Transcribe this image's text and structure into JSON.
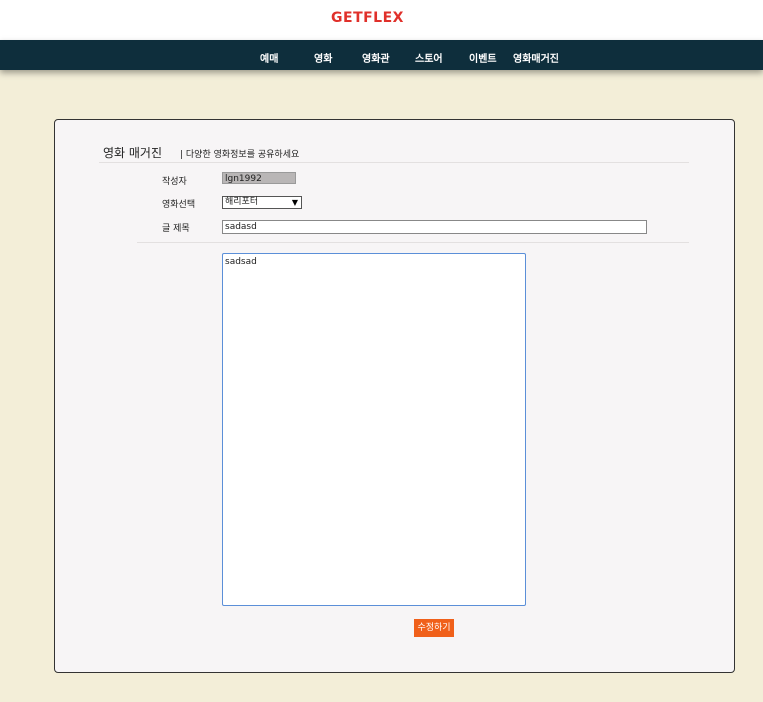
{
  "header": {
    "logo": "GETFLEX"
  },
  "nav": {
    "items": [
      "예매",
      "영화",
      "영화관",
      "스토어",
      "이벤트",
      "영화매거진"
    ]
  },
  "board": {
    "title": "영화 매거진",
    "subtitle": "| 다양한 영화정보를 공유하세요"
  },
  "form": {
    "author_label": "작성자",
    "author_value": "lgn1992",
    "movie_label": "영화선택",
    "movie_selected": "해리포터",
    "title_label": "글 제목",
    "title_value": "sadasd",
    "content_value": "sadsad",
    "submit_label": "수정하기"
  },
  "colors": {
    "logo": "#e0302a",
    "navbar": "#0e2e3c",
    "page_background": "#f3eed8",
    "submit_button": "#f0601a"
  }
}
